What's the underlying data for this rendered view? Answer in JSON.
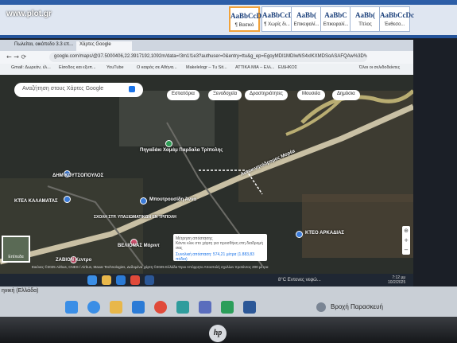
{
  "watermark": "www.plot.gr",
  "word_ribbon": {
    "styles": [
      {
        "sample": "AaBbCcDc",
        "name": "¶ Βασικό",
        "active": true
      },
      {
        "sample": "AaBbCcDc",
        "name": "¶ Χωρίς δι...",
        "active": false
      },
      {
        "sample": "AaBb(",
        "name": "Επικεφαλί...",
        "active": false
      },
      {
        "sample": "AaBbC",
        "name": "Επικεφαλί...",
        "active": false
      },
      {
        "sample": "AaBb(",
        "name": "Τίτλος",
        "active": false
      },
      {
        "sample": "AaBbCcDc",
        "name": "Έκθεσο...",
        "active": false
      }
    ]
  },
  "browser": {
    "tabs": [
      "Πωλείται, οικόπεδο 3.3 επ...",
      "Χάρτες Google"
    ],
    "url": "google.com/maps/@37.5000406,22.3917192,1092m/data=!3m1!1e3?authuser=0&entry=ttu&g_ep=EgoyMDI1MDIwNS4xIKXMDSoASAFQAw%3D%3D",
    "bookmarks": [
      "Gmail: Δωρεάν, έλ...",
      "Είσοδος και εξυπ...",
      "YouTube",
      "Ο καιρός σε Αθήνα...",
      "Makelelogr – Tu Sit...",
      "ΑΤΤΙΚΑ ΜΙΑ – Ελλ...",
      "ΕΙΔΗΚΟΣ",
      "Όλοι οι σελιδοδείκτες"
    ]
  },
  "map": {
    "search_placeholder": "Αναζήτηση στους Χάρτες Google",
    "chips": [
      "Εστιατόρια",
      "Ξενοδοχεία",
      "Δραστηριότητες",
      "Μουσεία",
      "Δημόσια"
    ],
    "places": [
      {
        "name": "Πηγαδάκι Χαμάμ Παρδαλα Τρίπολης",
        "color": "#2e9c55"
      },
      {
        "name": "ΣΧΟΛΗ ΣΤΡ. ΥΠΑΞΙΩΜΑΤΙΚΩΝ ΕΝ ΤΡΙΠΟΛΗ",
        "color": "#3b7bd8"
      },
      {
        "name": "ΔΗΜ ΚΟΥΤΣΟΠΟΥΛΟΣ",
        "color": "#3b7bd8"
      },
      {
        "name": "ΚΤΕΛ ΚΑΛΑΜΑΤΑΣ",
        "color": "#3b7bd8"
      },
      {
        "name": "Μπουτρουσίδη Άννα",
        "color": "#3b7bd8"
      },
      {
        "name": "ΚΤΕΟ ΑΡΚΑΔΙΑΣ",
        "color": "#3b7bd8"
      },
      {
        "name": "ΒΕΛΙΟΝΑΣ Μόριντ",
        "color": "#d04f6c"
      },
      {
        "name": "ΖΑΒΙΟΝ Κεντρο",
        "color": "#d04f6c"
      }
    ],
    "road_label": "Αυτοκινητόδρομος Μορέα",
    "popup": {
      "title": "Μέτρηση απόστασης",
      "hint": "Κάντε κλικ στο χάρτη για προσθήκη στη διαδρομή σας",
      "total": "Συνολική απόσταση: 574,21 μέτρα (1.883,83 πόδια)"
    },
    "layers_label": "Επίπεδα",
    "attribution": "Εικόνες ©2025 Airbus, CNES / Airbus, Maxar Technologies, Δεδομένα χάρτη ©2025  Ελλάδα  Όροι  Απόρρητο  Αποστολή σχολίων προϊόντος  200 μέτρα"
  },
  "inner_taskbar": {
    "weather": "8°C  Εντονες νεφώ...",
    "time": "7:12 μμ",
    "date": "10/2/2025"
  },
  "outer_taskbar": {
    "language": "ηνική (Ελλάδα)",
    "weather": "Βροχή Παρασκευή"
  },
  "laptop_logo": "hp"
}
